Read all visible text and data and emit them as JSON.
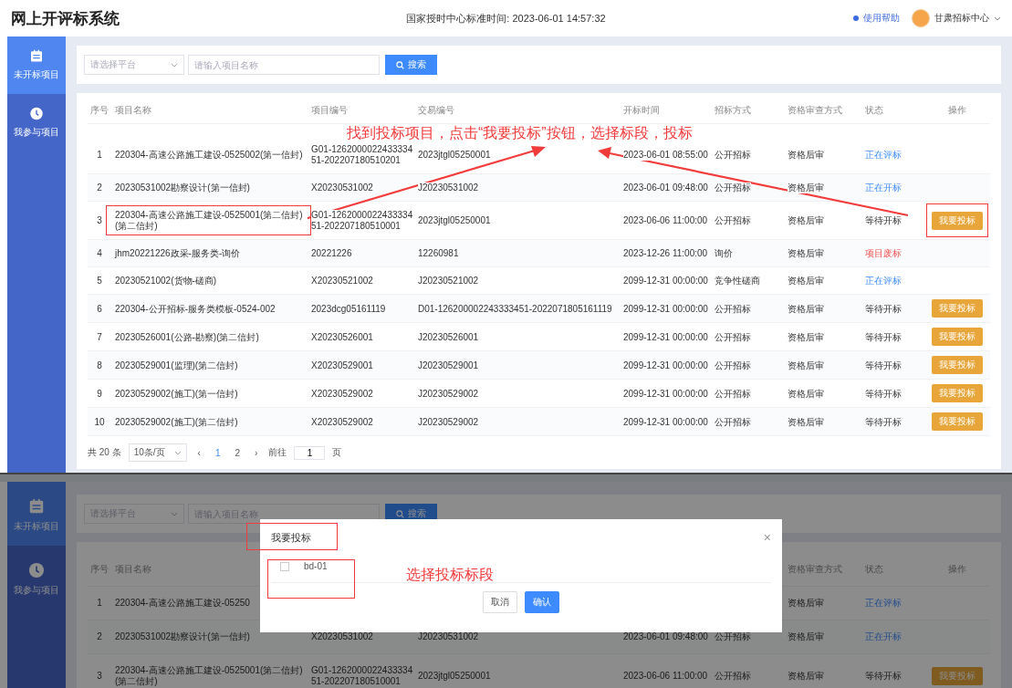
{
  "main_view": {
    "header": {
      "title": "网上开评标系统",
      "time": "国家授时中心标准时间: 2023-06-01 14:57:32",
      "help": "使用帮助",
      "user": "甘肃招标中心"
    },
    "sidebar": [
      {
        "label": "未开标项目",
        "selected": true,
        "kind": "calendar"
      },
      {
        "label": "我参与项目",
        "selected": false,
        "kind": "clock"
      }
    ],
    "search": {
      "platform_placeholder": "请选择平台",
      "name_placeholder": "请输入项目名称",
      "button": "搜索"
    },
    "table": {
      "columns": {
        "no": "序号",
        "name": "项目名称",
        "code": "项目编号",
        "trade": "交易编号",
        "time": "开标时间",
        "method": "招标方式",
        "review": "资格审查方式",
        "status": "状态",
        "action": "操作"
      },
      "rows": [
        {
          "no": "1",
          "name": "220304-高速公路施工建设-0525002(第一信封)",
          "code": "G01-126200002243333451-202207180510201",
          "trade": "2023jtgl05250001",
          "time": "2023-06-01 08:55:00",
          "method": "公开招标",
          "review": "资格后审",
          "status": "正在评标",
          "kind": "active"
        },
        {
          "no": "2",
          "name": "20230531002勘察设计(第一信封)",
          "code": "X20230531002",
          "trade": "J20230531002",
          "time": "2023-06-01 09:48:00",
          "method": "公开招标",
          "review": "资格后审",
          "status": "正在开标",
          "kind": "active"
        },
        {
          "no": "3",
          "name": "220304-高速公路施工建设-0525001(第二信封)(第二信封)",
          "code": "G01-126200002243333451-202207180510001",
          "trade": "2023jtgl05250001",
          "time": "2023-06-06 11:00:00",
          "method": "公开招标",
          "review": "资格后审",
          "status": "等待开标",
          "kind": "waiting",
          "action": "我要投标"
        },
        {
          "no": "4",
          "name": "jhm20221226政采-服务类-询价",
          "code": "20221226",
          "trade": "12260981",
          "time": "2023-12-26 11:00:00",
          "method": "询价",
          "review": "资格后审",
          "status": "项目废标",
          "kind": "failed"
        },
        {
          "no": "5",
          "name": "20230521002(货物-磋商)",
          "code": "X20230521002",
          "trade": "J20230521002",
          "time": "2099-12-31 00:00:00",
          "method": "竞争性磋商",
          "review": "资格后审",
          "status": "正在评标",
          "kind": "active"
        },
        {
          "no": "6",
          "name": "220304-公开招标-服务类模板-0524-002",
          "code": "2023dcg05161119",
          "trade": "D01-126200002243333451-2022071805161119",
          "time": "2099-12-31 00:00:00",
          "method": "公开招标",
          "review": "资格后审",
          "status": "等待开标",
          "kind": "waiting",
          "action": "我要投标"
        },
        {
          "no": "7",
          "name": "20230526001(公路-勘察)(第二信封)",
          "code": "X20230526001",
          "trade": "J20230526001",
          "time": "2099-12-31 00:00:00",
          "method": "公开招标",
          "review": "资格后审",
          "status": "等待开标",
          "kind": "waiting",
          "action": "我要投标"
        },
        {
          "no": "8",
          "name": "20230529001(监理)(第二信封)",
          "code": "X20230529001",
          "trade": "J20230529001",
          "time": "2099-12-31 00:00:00",
          "method": "公开招标",
          "review": "资格后审",
          "status": "等待开标",
          "kind": "waiting",
          "action": "我要投标"
        },
        {
          "no": "9",
          "name": "20230529002(施工)(第一信封)",
          "code": "X20230529002",
          "trade": "J20230529002",
          "time": "2099-12-31 00:00:00",
          "method": "公开招标",
          "review": "资格后审",
          "status": "等待开标",
          "kind": "waiting",
          "action": "我要投标"
        },
        {
          "no": "10",
          "name": "20230529002(施工)(第二信封)",
          "code": "X20230529002",
          "trade": "J20230529002",
          "time": "2099-12-31 00:00:00",
          "method": "公开招标",
          "review": "资格后审",
          "status": "等待开标",
          "kind": "waiting",
          "action": "我要投标"
        }
      ]
    },
    "pagination": {
      "total": "共 20 条",
      "page_size": "10条/页",
      "prev": "‹",
      "pages": [
        {
          "label": "1",
          "selected": true
        },
        {
          "label": "2",
          "selected": false
        }
      ],
      "next": "›",
      "goto": "前往",
      "goto_value": "1",
      "unit": "页"
    },
    "annotation": {
      "text": "找到投标项目，点击“我要投标”按钮，选择标段，投标"
    }
  },
  "dialog_view": {
    "sidebar": [
      {
        "label": "未开标项目",
        "selected": true,
        "kind": "calendar"
      },
      {
        "label": "我参与项目",
        "selected": false,
        "kind": "clock"
      }
    ],
    "search": {
      "platform_placeholder": "请选择平台",
      "name_placeholder": "请输入项目名称",
      "button": "搜索"
    },
    "table": {
      "columns": {
        "no": "序号",
        "name": "项目名称",
        "review": "资格审查方式",
        "status": "状态",
        "action": "操作"
      },
      "rows": [
        {
          "no": "1",
          "name": "220304-高速公路施工建设-05250",
          "review": "资格后审",
          "status": "正在评标",
          "kind": "active"
        },
        {
          "no": "2",
          "name": "20230531002勘察设计(第一信封)",
          "code": "X20230531002",
          "trade": "J20230531002",
          "time": "2023-06-01 09:48:00",
          "method": "公开招标",
          "review": "资格后审",
          "status": "正在开标",
          "kind": "active"
        },
        {
          "no": "3",
          "name": "220304-高速公路施工建设-0525001(第二信封)(第二信封)",
          "code": "G01-126200002243333451-202207180510001",
          "trade": "2023jtgl05250001",
          "time": "2023-06-06 11:00:00",
          "method": "公开招标",
          "review": "资格后审",
          "status": "等待开标",
          "kind": "waiting",
          "action": "我要投标"
        }
      ]
    },
    "dialog": {
      "title": "我要投标",
      "close": "×",
      "options": [
        {
          "label": "bd-01",
          "checked": false
        }
      ],
      "buttons": [
        {
          "label": "取消",
          "kind": "secondary"
        },
        {
          "label": "确认",
          "kind": "primary"
        }
      ]
    },
    "annotation": {
      "text": "选择投标标段"
    }
  }
}
